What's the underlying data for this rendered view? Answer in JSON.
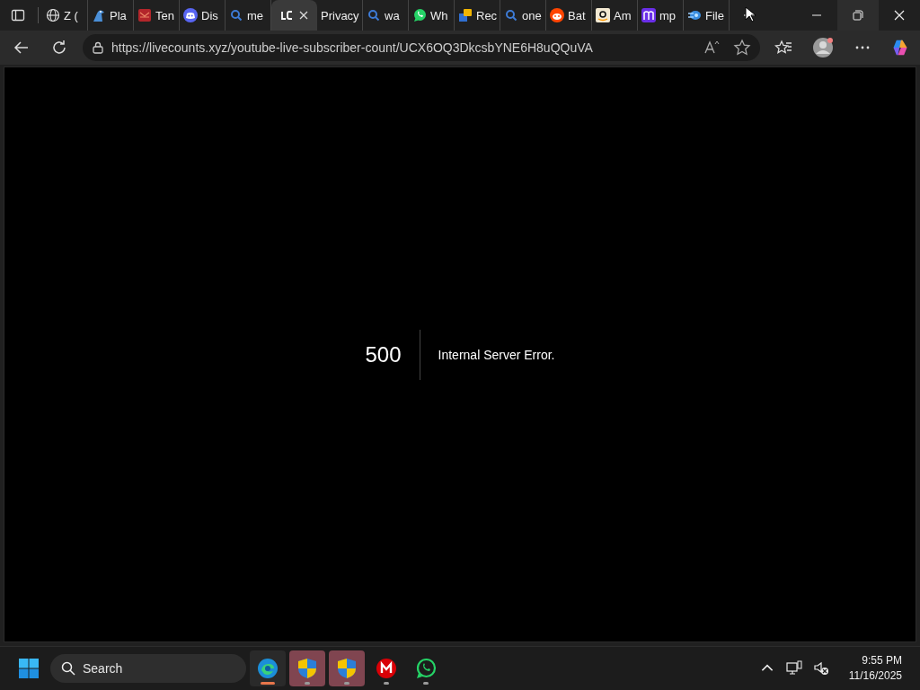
{
  "tabs": [
    {
      "label": "Z (",
      "kind": "globe",
      "selected": false
    },
    {
      "label": "Pla",
      "kind": "bird",
      "selected": false
    },
    {
      "label": "Ten",
      "kind": "redbox",
      "selected": false
    },
    {
      "label": "Dis",
      "kind": "discord",
      "selected": false
    },
    {
      "label": "me",
      "kind": "search",
      "selected": false
    },
    {
      "kind": "lc",
      "selected": true
    },
    {
      "label": "Privacy",
      "kind": "plain",
      "selected": false
    },
    {
      "label": "wa",
      "kind": "search",
      "selected": false
    },
    {
      "label": "Wh",
      "kind": "whatsapp",
      "selected": false
    },
    {
      "label": "Rec",
      "kind": "chat",
      "selected": false
    },
    {
      "label": "one",
      "kind": "search",
      "selected": false
    },
    {
      "label": "Bat",
      "kind": "reddit",
      "selected": false
    },
    {
      "label": "Am",
      "kind": "amazon",
      "selected": false
    },
    {
      "label": "mp",
      "kind": "mlogo",
      "selected": false
    },
    {
      "label": "File",
      "kind": "swirl",
      "selected": false
    }
  ],
  "address": {
    "url": "https://livecounts.xyz/youtube-live-subscriber-count/UCX6OQ3DkcsbYNE6H8uQQuVA"
  },
  "error": {
    "code": "500",
    "message": "Internal Server Error."
  },
  "taskbar": {
    "search": {
      "placeholder": "Search"
    },
    "apps": [
      {
        "kind": "edge",
        "selected": true,
        "flashing": false
      },
      {
        "kind": "shield",
        "selected": false,
        "flashing": true
      },
      {
        "kind": "shield",
        "selected": false,
        "flashing": true
      },
      {
        "kind": "mega",
        "selected": false,
        "flashing": false
      },
      {
        "kind": "whatsapp",
        "selected": false,
        "flashing": false
      }
    ],
    "clock": {
      "time": "9:55 PM",
      "date": "11/16/2025"
    }
  }
}
